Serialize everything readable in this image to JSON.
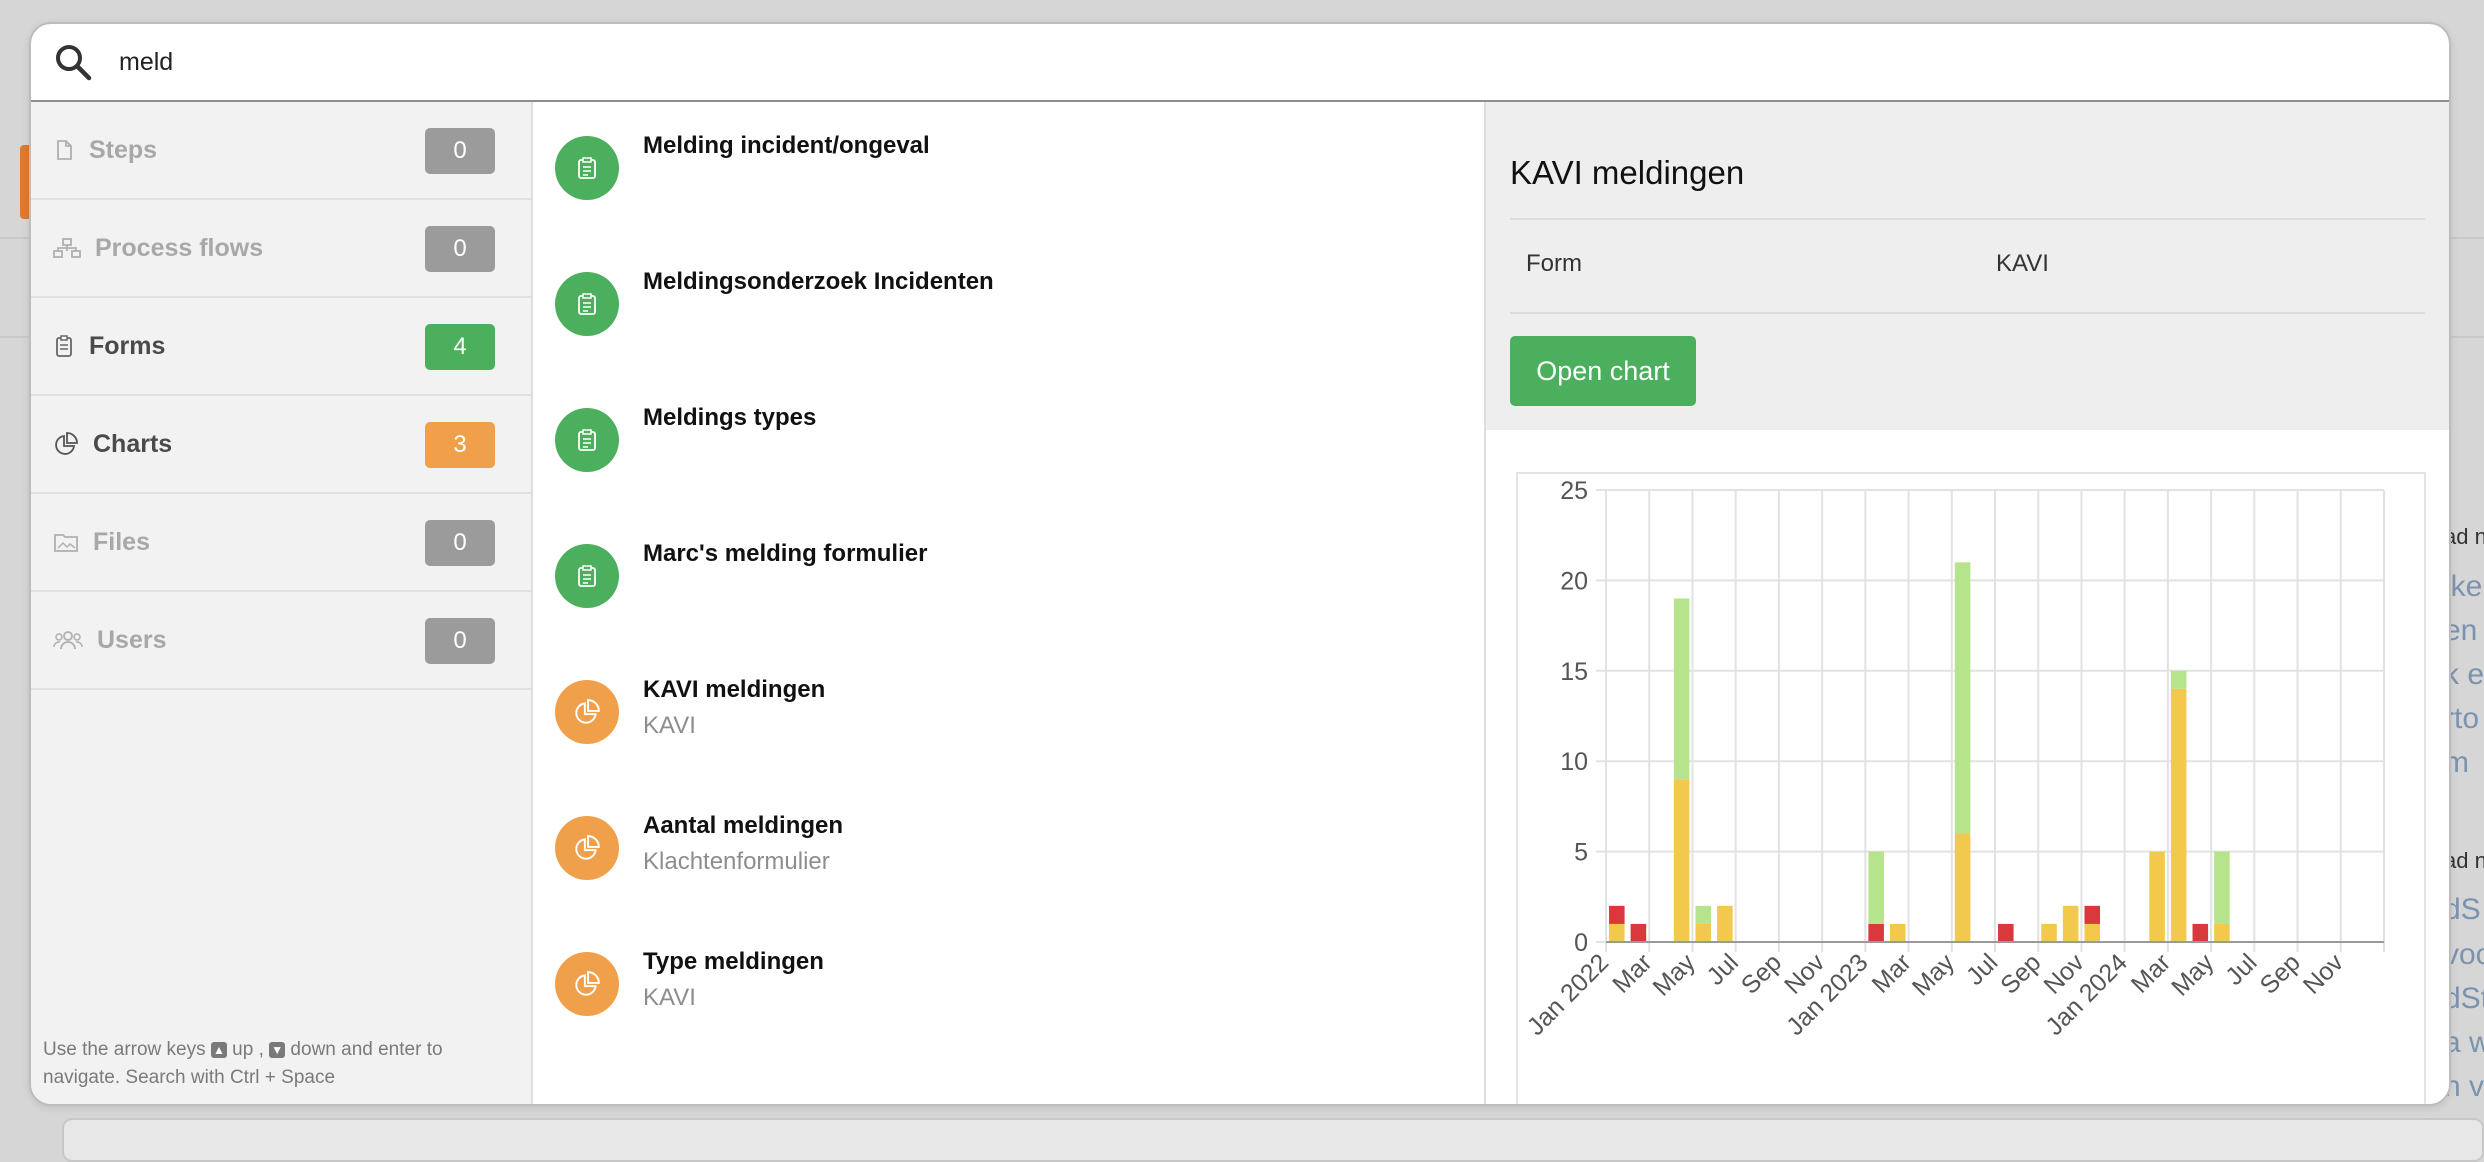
{
  "search": {
    "query": "meld"
  },
  "sidebar": {
    "items": [
      {
        "label": "Steps",
        "count": "0",
        "icon": "document-icon"
      },
      {
        "label": "Process flows",
        "count": "0",
        "icon": "sitemap-icon"
      },
      {
        "label": "Forms",
        "count": "4",
        "icon": "clipboard-icon"
      },
      {
        "label": "Charts",
        "count": "3",
        "icon": "pie-chart-icon"
      },
      {
        "label": "Files",
        "count": "0",
        "icon": "image-folder-icon"
      },
      {
        "label": "Users",
        "count": "0",
        "icon": "users-icon"
      }
    ],
    "hint": {
      "p1": "Use the arrow keys ",
      "p2": " up , ",
      "p3": " down and enter to navigate. Search with Ctrl + Space"
    }
  },
  "results": [
    {
      "title": "Melding incident/ongeval",
      "subtitle": "",
      "type": "form"
    },
    {
      "title": "Meldingsonderzoek Incidenten",
      "subtitle": "",
      "type": "form"
    },
    {
      "title": "Meldings types",
      "subtitle": "",
      "type": "form"
    },
    {
      "title": "Marc's melding formulier",
      "subtitle": "",
      "type": "form"
    },
    {
      "title": "KAVI meldingen",
      "subtitle": "KAVI",
      "type": "chart"
    },
    {
      "title": "Aantal meldingen",
      "subtitle": "Klachtenformulier",
      "type": "chart"
    },
    {
      "title": "Type meldingen",
      "subtitle": "KAVI",
      "type": "chart"
    }
  ],
  "detail": {
    "title": "KAVI meldingen",
    "row_key": "Form",
    "row_value": "KAVI",
    "open_button": "Open chart"
  },
  "background": {
    "right_texts_blue": [
      "jke",
      "en",
      "k e",
      "rto",
      " m",
      "dS",
      "voc",
      "dSt",
      "a w",
      "n vi"
    ],
    "right_texts_dark": [
      "ad n",
      "ad n"
    ]
  },
  "colors": {
    "green": "#4caf5d",
    "orange": "#f0a04a",
    "gray_badge": "#9b9b9b",
    "bar_yellow": "#f2c94c",
    "bar_red": "#d9393d",
    "bar_lightgreen": "#b5e48c"
  },
  "chart_data": {
    "type": "bar",
    "stacked": true,
    "ylim": [
      0,
      25
    ],
    "yticks": [
      0,
      5,
      10,
      15,
      20,
      25
    ],
    "grid": true,
    "categories": [
      "Jan 2022",
      "Feb 2022",
      "Mar 2022",
      "Apr 2022",
      "May 2022",
      "Jun 2022",
      "Jul 2022",
      "Aug 2022",
      "Sep 2022",
      "Oct 2022",
      "Nov 2022",
      "Dec 2022",
      "Jan 2023",
      "Feb 2023",
      "Mar 2023",
      "Apr 2023",
      "May 2023",
      "Jun 2023",
      "Jul 2023",
      "Aug 2023",
      "Sep 2023",
      "Oct 2023",
      "Nov 2023",
      "Dec 2023",
      "Jan 2024",
      "Feb 2024",
      "Mar 2024",
      "Apr 2024",
      "May 2024",
      "Jun 2024",
      "Jul 2024",
      "Aug 2024",
      "Sep 2024",
      "Oct 2024",
      "Nov 2024",
      "Dec 2024"
    ],
    "tick_labels": [
      "Jan 2022",
      "Mar",
      "May",
      "Jul",
      "Sep",
      "Nov",
      "Jan 2023",
      "Mar",
      "May",
      "Jul",
      "Sep",
      "Nov",
      "Jan 2024",
      "Mar",
      "May",
      "Jul",
      "Sep",
      "Nov"
    ],
    "series": [
      {
        "color": "#f2c94c",
        "values": [
          1,
          0,
          0,
          9,
          1,
          2,
          0,
          0,
          0,
          0,
          0,
          0,
          0,
          1,
          0,
          0,
          6,
          0,
          0,
          0,
          1,
          2,
          1,
          0,
          0,
          5,
          14,
          0,
          1,
          0,
          0,
          0,
          0,
          0,
          0,
          0
        ]
      },
      {
        "color": "#d9393d",
        "values": [
          1,
          1,
          0,
          0,
          0,
          0,
          0,
          0,
          0,
          0,
          0,
          0,
          1,
          0,
          0,
          0,
          0,
          0,
          1,
          0,
          0,
          0,
          1,
          0,
          0,
          0,
          0,
          1,
          0,
          0,
          0,
          0,
          0,
          0,
          0,
          0
        ]
      },
      {
        "color": "#b5e48c",
        "values": [
          0,
          0,
          0,
          10,
          1,
          0,
          0,
          0,
          0,
          0,
          0,
          0,
          4,
          0,
          0,
          0,
          15,
          0,
          0,
          0,
          0,
          0,
          0,
          0,
          0,
          0,
          1,
          0,
          4,
          0,
          0,
          0,
          0,
          0,
          0,
          0
        ]
      }
    ]
  }
}
